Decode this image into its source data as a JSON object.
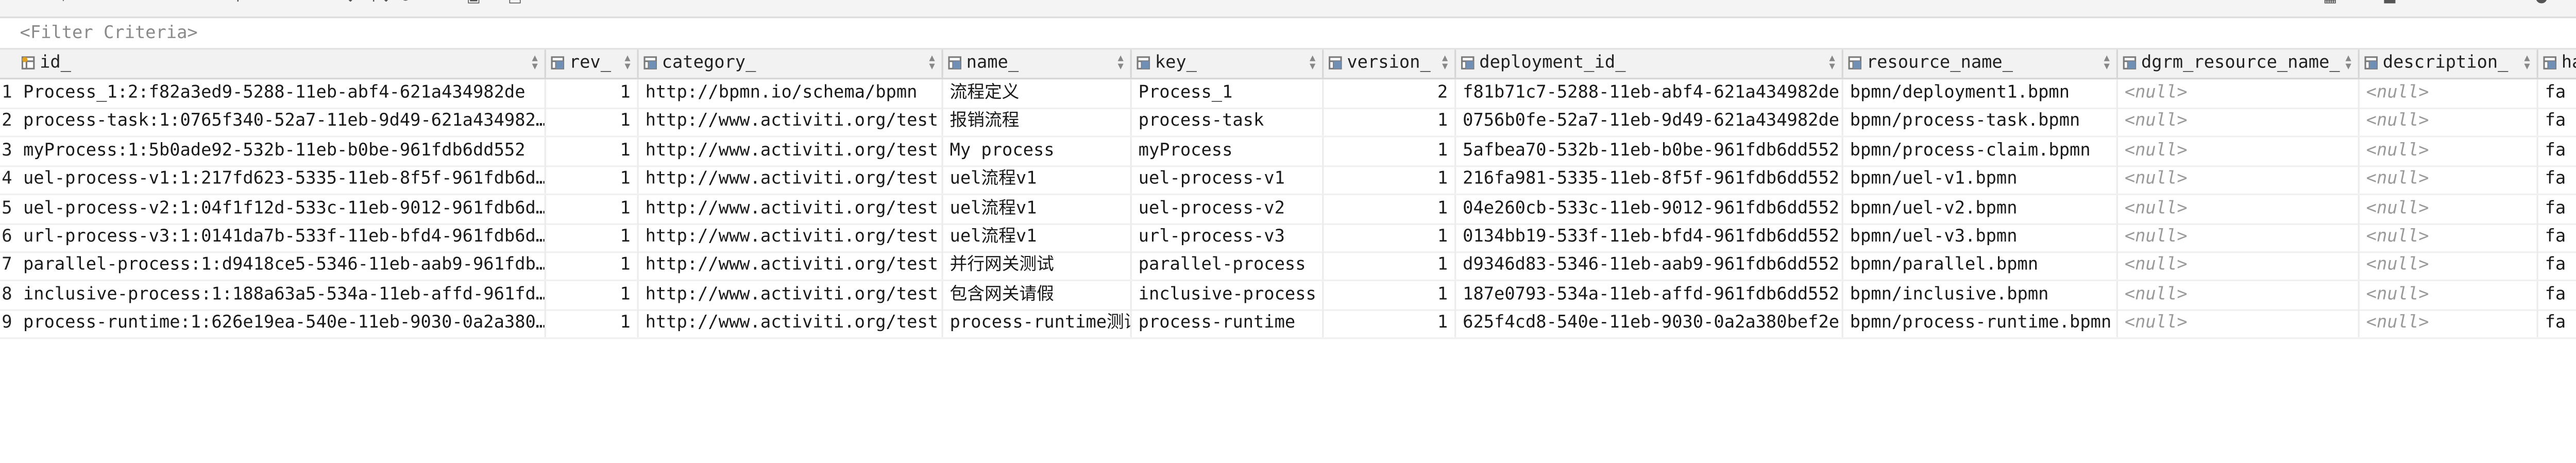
{
  "filter": {
    "placeholder": "<Filter Criteria>"
  },
  "toolbar": {
    "items": [
      "▾",
      "↑",
      "↓",
      "↑↓",
      "⟳",
      "↩",
      "▣",
      "□",
      "▦",
      "■",
      "●"
    ]
  },
  "columns": [
    {
      "key": "id",
      "label": "id_",
      "icon": "primary-key-icon"
    },
    {
      "key": "rev",
      "label": "rev_",
      "icon": "column-icon"
    },
    {
      "key": "category",
      "label": "category_",
      "icon": "column-icon"
    },
    {
      "key": "name",
      "label": "name_",
      "icon": "column-icon"
    },
    {
      "key": "key",
      "label": "key_",
      "icon": "column-icon"
    },
    {
      "key": "version",
      "label": "version_",
      "icon": "column-icon"
    },
    {
      "key": "deployment_id",
      "label": "deployment_id_",
      "icon": "column-icon"
    },
    {
      "key": "resource_name",
      "label": "resource_name_",
      "icon": "column-icon"
    },
    {
      "key": "dgrm_resource_name",
      "label": "dgrm_resource_name_",
      "icon": "column-icon"
    },
    {
      "key": "description",
      "label": "description_",
      "icon": "column-icon"
    },
    {
      "key": "has",
      "label": "has",
      "icon": "column-icon"
    }
  ],
  "rows": [
    {
      "n": "1",
      "id": "Process_1:2:f82a3ed9-5288-11eb-abf4-621a434982de",
      "rev": "1",
      "category": "http://bpmn.io/schema/bpmn",
      "name": "流程定义",
      "key": "Process_1",
      "version": "2",
      "deployment_id": "f81b71c7-5288-11eb-abf4-621a434982de",
      "resource_name": "bpmn/deployment1.bpmn",
      "dgrm_resource_name": "<null>",
      "description": "<null>",
      "has": "fa"
    },
    {
      "n": "2",
      "id": "process-task:1:0765f340-52a7-11eb-9d49-621a434982…",
      "rev": "1",
      "category": "http://www.activiti.org/test",
      "name": "报销流程",
      "key": "process-task",
      "version": "1",
      "deployment_id": "0756b0fe-52a7-11eb-9d49-621a434982de",
      "resource_name": "bpmn/process-task.bpmn",
      "dgrm_resource_name": "<null>",
      "description": "<null>",
      "has": "fa"
    },
    {
      "n": "3",
      "id": "myProcess:1:5b0ade92-532b-11eb-b0be-961fdb6dd552",
      "rev": "1",
      "category": "http://www.activiti.org/test",
      "name": "My process",
      "key": "myProcess",
      "version": "1",
      "deployment_id": "5afbea70-532b-11eb-b0be-961fdb6dd552",
      "resource_name": "bpmn/process-claim.bpmn",
      "dgrm_resource_name": "<null>",
      "description": "<null>",
      "has": "fa"
    },
    {
      "n": "4",
      "id": "uel-process-v1:1:217fd623-5335-11eb-8f5f-961fdb6d…",
      "rev": "1",
      "category": "http://www.activiti.org/test",
      "name": "uel流程v1",
      "key": "uel-process-v1",
      "version": "1",
      "deployment_id": "216fa981-5335-11eb-8f5f-961fdb6dd552",
      "resource_name": "bpmn/uel-v1.bpmn",
      "dgrm_resource_name": "<null>",
      "description": "<null>",
      "has": "fa"
    },
    {
      "n": "5",
      "id": "uel-process-v2:1:04f1f12d-533c-11eb-9012-961fdb6d…",
      "rev": "1",
      "category": "http://www.activiti.org/test",
      "name": "uel流程v1",
      "key": "uel-process-v2",
      "version": "1",
      "deployment_id": "04e260cb-533c-11eb-9012-961fdb6dd552",
      "resource_name": "bpmn/uel-v2.bpmn",
      "dgrm_resource_name": "<null>",
      "description": "<null>",
      "has": "fa"
    },
    {
      "n": "6",
      "id": "url-process-v3:1:0141da7b-533f-11eb-bfd4-961fdb6d…",
      "rev": "1",
      "category": "http://www.activiti.org/test",
      "name": "uel流程v1",
      "key": "url-process-v3",
      "version": "1",
      "deployment_id": "0134bb19-533f-11eb-bfd4-961fdb6dd552",
      "resource_name": "bpmn/uel-v3.bpmn",
      "dgrm_resource_name": "<null>",
      "description": "<null>",
      "has": "fa"
    },
    {
      "n": "7",
      "id": "parallel-process:1:d9418ce5-5346-11eb-aab9-961fdb…",
      "rev": "1",
      "category": "http://www.activiti.org/test",
      "name": "并行网关测试",
      "key": "parallel-process",
      "version": "1",
      "deployment_id": "d9346d83-5346-11eb-aab9-961fdb6dd552",
      "resource_name": "bpmn/parallel.bpmn",
      "dgrm_resource_name": "<null>",
      "description": "<null>",
      "has": "fa"
    },
    {
      "n": "8",
      "id": "inclusive-process:1:188a63a5-534a-11eb-affd-961fd…",
      "rev": "1",
      "category": "http://www.activiti.org/test",
      "name": "包含网关请假",
      "key": "inclusive-process",
      "version": "1",
      "deployment_id": "187e0793-534a-11eb-affd-961fdb6dd552",
      "resource_name": "bpmn/inclusive.bpmn",
      "dgrm_resource_name": "<null>",
      "description": "<null>",
      "has": "fa"
    },
    {
      "n": "9",
      "id": "process-runtime:1:626e19ea-540e-11eb-9030-0a2a380…",
      "rev": "1",
      "category": "http://www.activiti.org/test",
      "name": "process-runtime测试",
      "key": "process-runtime",
      "version": "1",
      "deployment_id": "625f4cd8-540e-11eb-9030-0a2a380bef2e",
      "resource_name": "bpmn/process-runtime.bpmn",
      "dgrm_resource_name": "<null>",
      "description": "<null>",
      "has": "fa"
    }
  ]
}
